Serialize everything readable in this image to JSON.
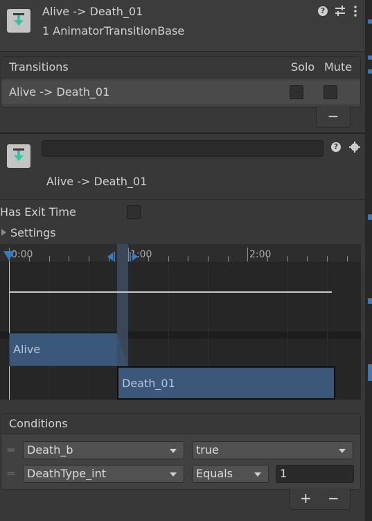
{
  "header": {
    "title": "Alive -> Death_01",
    "subtitle": "1 AnimatorTransitionBase",
    "icons": [
      "help-icon",
      "sliders-icon",
      "more-icon"
    ]
  },
  "transitions_list": {
    "header_label": "Transitions",
    "solo_label": "Solo",
    "mute_label": "Mute",
    "rows": [
      {
        "label": "Alive -> Death_01",
        "solo": false,
        "mute": false
      }
    ],
    "remove_label": "−"
  },
  "inspector": {
    "name_value": "",
    "title": "Alive -> Death_01",
    "icons": [
      "help-icon",
      "gear-icon"
    ]
  },
  "settings": {
    "has_exit_time_label": "Has Exit Time",
    "has_exit_time": false,
    "foldout_label": "Settings"
  },
  "timeline": {
    "ticks": [
      "0:00",
      "1:00",
      "2:00"
    ],
    "source_state": "Alive",
    "destination_state": "Death_01",
    "colors": {
      "state_block": "#3b5779",
      "transition_band": "#3d4e63",
      "marker": "#3a79bb"
    }
  },
  "conditions": {
    "header_label": "Conditions",
    "rows": [
      {
        "parameter": "Death_b",
        "mode": "true",
        "value": null
      },
      {
        "parameter": "DeathType_int",
        "mode": "Equals",
        "value": "1"
      }
    ],
    "add_label": "+",
    "remove_label": "−"
  }
}
